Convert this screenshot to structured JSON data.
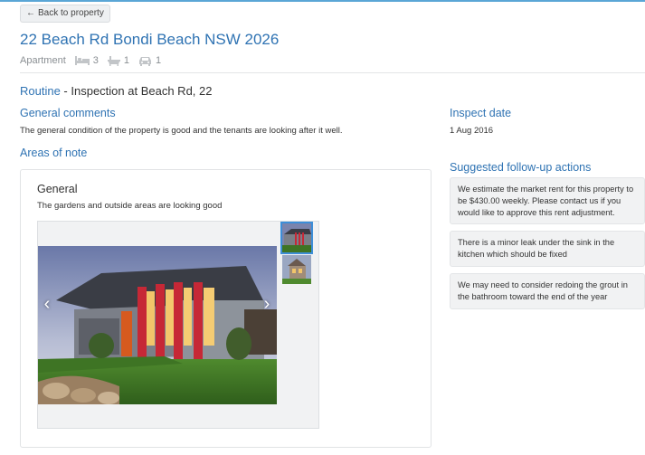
{
  "back_button": {
    "label": "Back to property"
  },
  "property": {
    "address": "22 Beach Rd Bondi Beach NSW 2026",
    "type": "Apartment",
    "bedrooms": "3",
    "bathrooms": "1",
    "parking": "1"
  },
  "inspection": {
    "type": "Routine",
    "separator": " - ",
    "title": "Inspection at Beach Rd, 22"
  },
  "general_comments": {
    "heading": "General comments",
    "text": "The general condition of the property is good and the tenants are looking after it well."
  },
  "inspect_date": {
    "heading": "Inspect date",
    "value": "1 Aug 2016"
  },
  "areas_of_note": {
    "heading": "Areas of note",
    "areas": [
      {
        "title": "General",
        "description": "The gardens and outside areas are looking good"
      }
    ]
  },
  "follow_up": {
    "heading": "Suggested follow-up actions",
    "actions": [
      "We estimate the market rent for this property to be $430.00 weekly. Please contact us if you would like to approve this rent adjustment.",
      "There is a minor leak under the sink in the kitchen which should be fixed",
      "We may need to consider redoing the grout in the bathroom toward the end of the year"
    ]
  },
  "colors": {
    "link_blue": "#2f73b3",
    "accent_blue": "#3c8ed8"
  },
  "icons": [
    "arrow-left-icon",
    "bed-icon",
    "bath-icon",
    "car-icon",
    "chevron-left-icon",
    "chevron-right-icon"
  ]
}
